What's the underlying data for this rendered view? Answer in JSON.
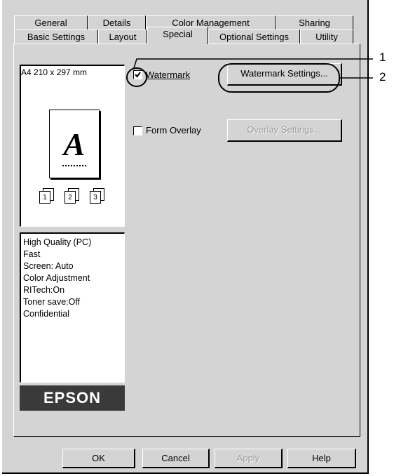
{
  "tabs_back": [
    {
      "label": "General"
    },
    {
      "label": "Details"
    },
    {
      "label": "Color Management"
    },
    {
      "label": "Sharing"
    }
  ],
  "tabs_front": [
    {
      "label": "Basic Settings"
    },
    {
      "label": "Layout"
    },
    {
      "label": "Special"
    },
    {
      "label": "Optional Settings"
    },
    {
      "label": "Utility"
    }
  ],
  "preview": {
    "paper_label": "A4 210 x 297 mm",
    "page_letter": "A",
    "copies": [
      "1",
      "2",
      "3"
    ]
  },
  "info_lines": [
    "High Quality (PC)",
    "Fast",
    "Screen: Auto",
    "Color Adjustment",
    "RITech:On",
    "Toner save:Off",
    "Confidential"
  ],
  "brand": "EPSON",
  "watermark": {
    "checked": true,
    "label": "Watermark",
    "button": "Watermark Settings..."
  },
  "overlay": {
    "checked": false,
    "label": "Form Overlay",
    "button": "Overlay Settings..."
  },
  "callouts": [
    "1",
    "2"
  ],
  "footer": {
    "ok": "OK",
    "cancel": "Cancel",
    "apply": "Apply",
    "help": "Help"
  }
}
